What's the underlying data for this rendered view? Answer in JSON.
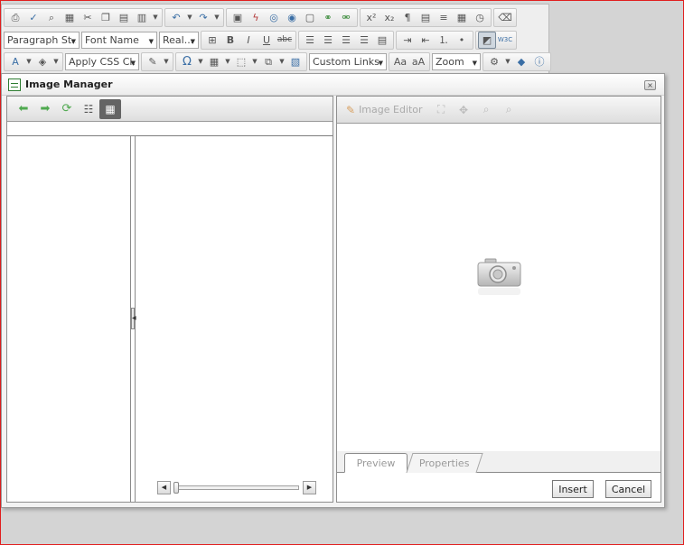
{
  "editor_toolbar": {
    "row1_icons": [
      "print-icon",
      "spellcheck-icon",
      "find-icon",
      "select-all-icon",
      "cut-icon",
      "copy-icon",
      "paste-icon",
      "paste-options-icon",
      "undo-icon",
      "redo-icon",
      "image-icon",
      "flash-icon",
      "media-icon",
      "document-icon",
      "link-icon",
      "unlink-icon",
      "superscript-icon",
      "subscript-icon",
      "paragraph-icon",
      "insert-table-icon",
      "horizontal-rule-icon",
      "date-icon",
      "time-icon",
      "format-stripper-icon"
    ],
    "paragraph_style": "Paragraph St...",
    "font_name": "Font Name",
    "font_size": "Real...",
    "bold": "B",
    "italic": "I",
    "underline": "U",
    "strike": "abc",
    "css_class": "Apply CSS Cl...",
    "omega": "Ω",
    "custom_links": "Custom Links",
    "zoom": "Zoom",
    "font_color_label": "A"
  },
  "dialog": {
    "title": "Image Manager",
    "close_label": "×",
    "preview_toolbar": {
      "image_editor_label": "Image Editor"
    },
    "tabs": {
      "preview": "Preview",
      "properties": "Properties"
    },
    "buttons": {
      "insert": "Insert",
      "cancel": "Cancel"
    }
  }
}
